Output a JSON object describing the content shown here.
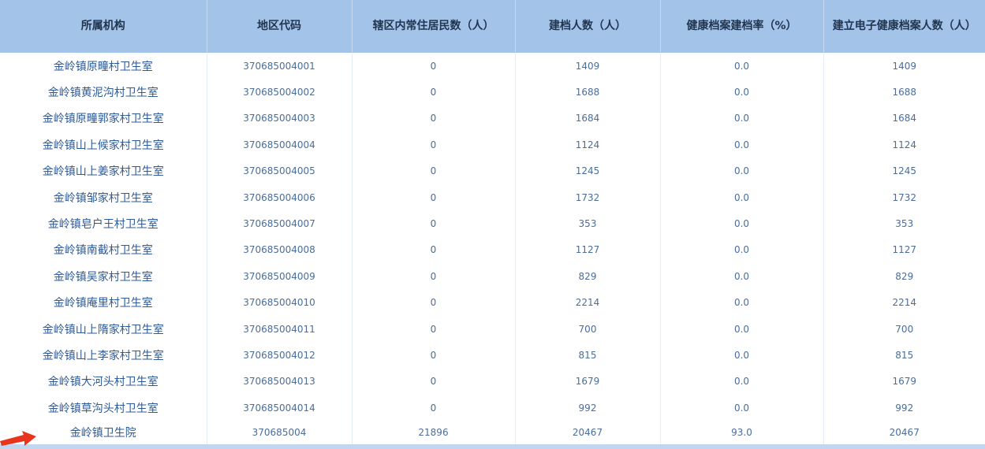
{
  "table": {
    "headers": [
      "所属机构",
      "地区代码",
      "辖区内常住居民数（人）",
      "建档人数（人）",
      "健康档案建档率（%）",
      "建立电子健康档案人数（人）"
    ],
    "rows": [
      [
        "金岭镇原疃村卫生室",
        "370685004001",
        "0",
        "1409",
        "0.0",
        "1409"
      ],
      [
        "金岭镇黄泥沟村卫生室",
        "370685004002",
        "0",
        "1688",
        "0.0",
        "1688"
      ],
      [
        "金岭镇原疃郭家村卫生室",
        "370685004003",
        "0",
        "1684",
        "0.0",
        "1684"
      ],
      [
        "金岭镇山上候家村卫生室",
        "370685004004",
        "0",
        "1124",
        "0.0",
        "1124"
      ],
      [
        "金岭镇山上姜家村卫生室",
        "370685004005",
        "0",
        "1245",
        "0.0",
        "1245"
      ],
      [
        "金岭镇邹家村卫生室",
        "370685004006",
        "0",
        "1732",
        "0.0",
        "1732"
      ],
      [
        "金岭镇皂户王村卫生室",
        "370685004007",
        "0",
        "353",
        "0.0",
        "353"
      ],
      [
        "金岭镇南截村卫生室",
        "370685004008",
        "0",
        "1127",
        "0.0",
        "1127"
      ],
      [
        "金岭镇吴家村卫生室",
        "370685004009",
        "0",
        "829",
        "0.0",
        "829"
      ],
      [
        "金岭镇庵里村卫生室",
        "370685004010",
        "0",
        "2214",
        "0.0",
        "2214"
      ],
      [
        "金岭镇山上隋家村卫生室",
        "370685004011",
        "0",
        "700",
        "0.0",
        "700"
      ],
      [
        "金岭镇山上李家村卫生室",
        "370685004012",
        "0",
        "815",
        "0.0",
        "815"
      ],
      [
        "金岭镇大河头村卫生室",
        "370685004013",
        "0",
        "1679",
        "0.0",
        "1679"
      ],
      [
        "金岭镇草沟头村卫生室",
        "370685004014",
        "0",
        "992",
        "0.0",
        "992"
      ],
      [
        "金岭镇卫生院",
        "370685004",
        "21896",
        "20467",
        "93.0",
        "20467"
      ]
    ]
  },
  "annotation": {
    "icon": "red-arrow-icon",
    "color": "#e8341c"
  },
  "colors": {
    "header_bg": "#a4c3e9",
    "header_text": "#1f3550",
    "org_text": "#2d5a98",
    "cell_text": "#4a6d9a"
  }
}
